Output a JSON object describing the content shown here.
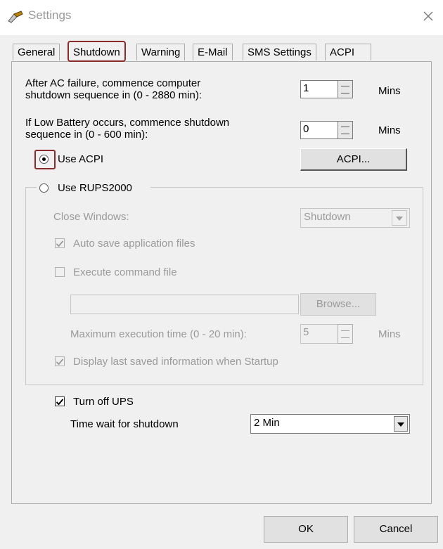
{
  "window": {
    "title": "Settings"
  },
  "tabs": [
    {
      "label": "General"
    },
    {
      "label": "Shutdown"
    },
    {
      "label": "Warning"
    },
    {
      "label": "E-Mail"
    },
    {
      "label": "SMS Settings"
    },
    {
      "label": "ACPI"
    }
  ],
  "ac_failure": {
    "label_line1": "After AC failure, commence computer",
    "label_line2": "shutdown sequence in (0 - 2880 min):",
    "value": "1",
    "unit": "Mins"
  },
  "low_battery": {
    "label_line1": "If Low Battery occurs, commence shutdown",
    "label_line2": "sequence in (0 - 600 min):",
    "value": "0",
    "unit": "Mins"
  },
  "use_acpi": {
    "label": "Use ACPI",
    "selected": true,
    "button": "ACPI..."
  },
  "use_rups": {
    "label": "Use RUPS2000",
    "selected": false,
    "close_windows_label": "Close Windows:",
    "close_windows_value": "Shutdown",
    "auto_save_label": "Auto save application files",
    "execute_label": "Execute command file",
    "command_file_value": "",
    "browse_button": "Browse...",
    "max_exec_label": "Maximum execution time (0 - 20 min):",
    "max_exec_value": "5",
    "max_exec_unit": "Mins",
    "display_last_label": "Display last saved information when Startup"
  },
  "turn_off_ups": {
    "label": "Turn off UPS",
    "checked": true
  },
  "time_wait": {
    "label": "Time wait for shutdown",
    "value": "2 Min"
  },
  "buttons": {
    "ok": "OK",
    "cancel": "Cancel"
  }
}
